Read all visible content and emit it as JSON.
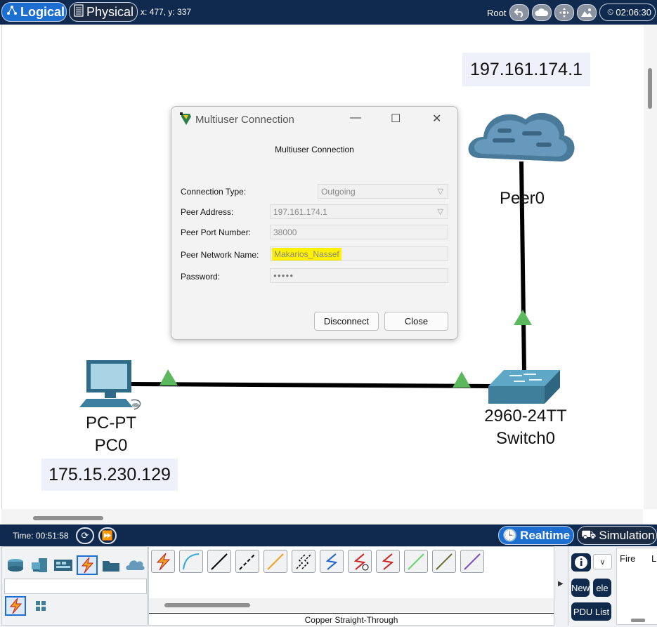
{
  "topbar": {
    "logical_label": "Logical",
    "physical_label": "Physical",
    "coords": "x: 477, y: 337",
    "root_label": "Root",
    "clock": "02:06:30"
  },
  "workspace": {
    "peer_address_label": "197.161.174.1",
    "peer_name": "Peer0",
    "pc_type": "PC-PT",
    "pc_name": "PC0",
    "pc_address_label": "175.15.230.129",
    "switch_model": "2960-24TT",
    "switch_name": "Switch0",
    "link_color": "#000000",
    "link_light_color": "#5cb85c"
  },
  "dialog": {
    "title": "Multiuser Connection",
    "heading": "Multiuser Connection",
    "fields": [
      {
        "label": "Connection Type:",
        "value": "Outgoing"
      },
      {
        "label": "Peer Address:",
        "value": "197.161.174.1"
      },
      {
        "label": "Peer Port Number:",
        "value": "38000"
      },
      {
        "label": "Peer Network Name:",
        "value": "Makarios_Nassef"
      },
      {
        "label": "Password:",
        "value": "●●●●●"
      }
    ],
    "disconnect_label": "Disconnect",
    "close_label": "Close",
    "highlight_color": "#ffef00"
  },
  "statusbar": {
    "time": "Time: 00:51:58",
    "realtime_label": "Realtime",
    "simulation_label": "Simulation"
  },
  "bottom": {
    "selected_cable": "Copper Straight-Through",
    "pdu_new": "New",
    "pdu_delete": "ele",
    "pdu_list": "PDU List",
    "col_fire": "Fire",
    "col_last": "L"
  }
}
